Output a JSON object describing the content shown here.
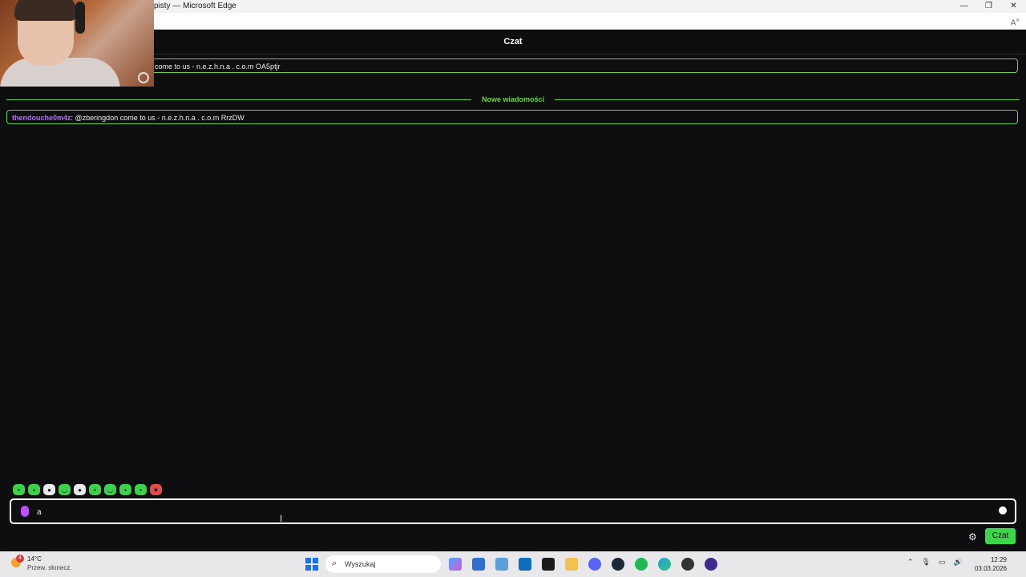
{
  "window": {
    "title": "pisty — Microsoft Edge",
    "controls": [
      "minimize-icon",
      "restore-icon",
      "close-icon"
    ]
  },
  "chat": {
    "header": "Czat",
    "messages": [
      {
        "user": "",
        "text": "come to us - n.e.z.h.n.a . c.o.m OA5ptjr"
      },
      {
        "user": "thendouche0m4z",
        "text": "@zberingdon come to us - n.e.z.h.n.a . c.o.m RrzDW"
      }
    ],
    "new_messages_label": "Nowe wiadomości",
    "input_value": "a",
    "send_label": "Czat",
    "colors": {
      "accent": "#3cd64a",
      "username": "#b66bff",
      "background": "#0e0e10"
    }
  },
  "emotes": [
    "emote-1",
    "emote-2",
    "emote-3",
    "emote-4",
    "emote-5",
    "emote-6",
    "emote-7",
    "emote-8",
    "emote-9",
    "emote-10"
  ],
  "taskbar": {
    "weather_temp": "14°C",
    "weather_desc": "Przew. słonecz.",
    "notification_count": "4",
    "search_placeholder": "Wyszukaj",
    "time": "12:29",
    "date": "03.03.2026"
  }
}
